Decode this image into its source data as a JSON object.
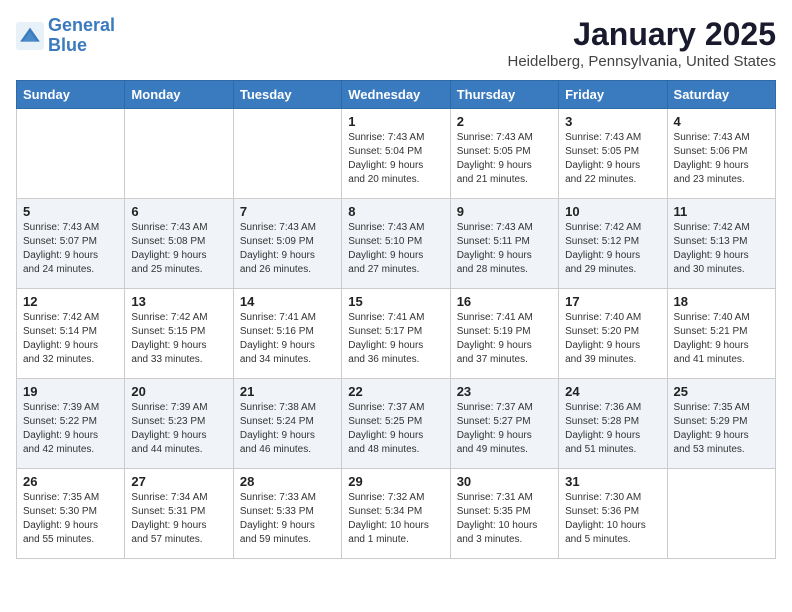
{
  "header": {
    "logo_line1": "General",
    "logo_line2": "Blue",
    "month": "January 2025",
    "location": "Heidelberg, Pennsylvania, United States"
  },
  "days_of_week": [
    "Sunday",
    "Monday",
    "Tuesday",
    "Wednesday",
    "Thursday",
    "Friday",
    "Saturday"
  ],
  "weeks": [
    [
      {
        "day": "",
        "info": ""
      },
      {
        "day": "",
        "info": ""
      },
      {
        "day": "",
        "info": ""
      },
      {
        "day": "1",
        "info": "Sunrise: 7:43 AM\nSunset: 5:04 PM\nDaylight: 9 hours\nand 20 minutes."
      },
      {
        "day": "2",
        "info": "Sunrise: 7:43 AM\nSunset: 5:05 PM\nDaylight: 9 hours\nand 21 minutes."
      },
      {
        "day": "3",
        "info": "Sunrise: 7:43 AM\nSunset: 5:05 PM\nDaylight: 9 hours\nand 22 minutes."
      },
      {
        "day": "4",
        "info": "Sunrise: 7:43 AM\nSunset: 5:06 PM\nDaylight: 9 hours\nand 23 minutes."
      }
    ],
    [
      {
        "day": "5",
        "info": "Sunrise: 7:43 AM\nSunset: 5:07 PM\nDaylight: 9 hours\nand 24 minutes."
      },
      {
        "day": "6",
        "info": "Sunrise: 7:43 AM\nSunset: 5:08 PM\nDaylight: 9 hours\nand 25 minutes."
      },
      {
        "day": "7",
        "info": "Sunrise: 7:43 AM\nSunset: 5:09 PM\nDaylight: 9 hours\nand 26 minutes."
      },
      {
        "day": "8",
        "info": "Sunrise: 7:43 AM\nSunset: 5:10 PM\nDaylight: 9 hours\nand 27 minutes."
      },
      {
        "day": "9",
        "info": "Sunrise: 7:43 AM\nSunset: 5:11 PM\nDaylight: 9 hours\nand 28 minutes."
      },
      {
        "day": "10",
        "info": "Sunrise: 7:42 AM\nSunset: 5:12 PM\nDaylight: 9 hours\nand 29 minutes."
      },
      {
        "day": "11",
        "info": "Sunrise: 7:42 AM\nSunset: 5:13 PM\nDaylight: 9 hours\nand 30 minutes."
      }
    ],
    [
      {
        "day": "12",
        "info": "Sunrise: 7:42 AM\nSunset: 5:14 PM\nDaylight: 9 hours\nand 32 minutes."
      },
      {
        "day": "13",
        "info": "Sunrise: 7:42 AM\nSunset: 5:15 PM\nDaylight: 9 hours\nand 33 minutes."
      },
      {
        "day": "14",
        "info": "Sunrise: 7:41 AM\nSunset: 5:16 PM\nDaylight: 9 hours\nand 34 minutes."
      },
      {
        "day": "15",
        "info": "Sunrise: 7:41 AM\nSunset: 5:17 PM\nDaylight: 9 hours\nand 36 minutes."
      },
      {
        "day": "16",
        "info": "Sunrise: 7:41 AM\nSunset: 5:19 PM\nDaylight: 9 hours\nand 37 minutes."
      },
      {
        "day": "17",
        "info": "Sunrise: 7:40 AM\nSunset: 5:20 PM\nDaylight: 9 hours\nand 39 minutes."
      },
      {
        "day": "18",
        "info": "Sunrise: 7:40 AM\nSunset: 5:21 PM\nDaylight: 9 hours\nand 41 minutes."
      }
    ],
    [
      {
        "day": "19",
        "info": "Sunrise: 7:39 AM\nSunset: 5:22 PM\nDaylight: 9 hours\nand 42 minutes."
      },
      {
        "day": "20",
        "info": "Sunrise: 7:39 AM\nSunset: 5:23 PM\nDaylight: 9 hours\nand 44 minutes."
      },
      {
        "day": "21",
        "info": "Sunrise: 7:38 AM\nSunset: 5:24 PM\nDaylight: 9 hours\nand 46 minutes."
      },
      {
        "day": "22",
        "info": "Sunrise: 7:37 AM\nSunset: 5:25 PM\nDaylight: 9 hours\nand 48 minutes."
      },
      {
        "day": "23",
        "info": "Sunrise: 7:37 AM\nSunset: 5:27 PM\nDaylight: 9 hours\nand 49 minutes."
      },
      {
        "day": "24",
        "info": "Sunrise: 7:36 AM\nSunset: 5:28 PM\nDaylight: 9 hours\nand 51 minutes."
      },
      {
        "day": "25",
        "info": "Sunrise: 7:35 AM\nSunset: 5:29 PM\nDaylight: 9 hours\nand 53 minutes."
      }
    ],
    [
      {
        "day": "26",
        "info": "Sunrise: 7:35 AM\nSunset: 5:30 PM\nDaylight: 9 hours\nand 55 minutes."
      },
      {
        "day": "27",
        "info": "Sunrise: 7:34 AM\nSunset: 5:31 PM\nDaylight: 9 hours\nand 57 minutes."
      },
      {
        "day": "28",
        "info": "Sunrise: 7:33 AM\nSunset: 5:33 PM\nDaylight: 9 hours\nand 59 minutes."
      },
      {
        "day": "29",
        "info": "Sunrise: 7:32 AM\nSunset: 5:34 PM\nDaylight: 10 hours\nand 1 minute."
      },
      {
        "day": "30",
        "info": "Sunrise: 7:31 AM\nSunset: 5:35 PM\nDaylight: 10 hours\nand 3 minutes."
      },
      {
        "day": "31",
        "info": "Sunrise: 7:30 AM\nSunset: 5:36 PM\nDaylight: 10 hours\nand 5 minutes."
      },
      {
        "day": "",
        "info": ""
      }
    ]
  ]
}
